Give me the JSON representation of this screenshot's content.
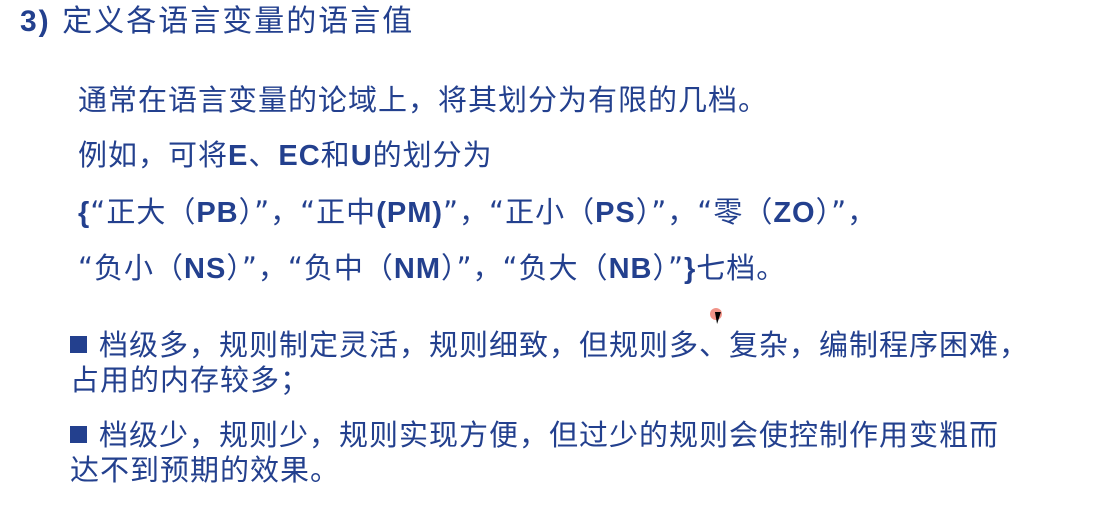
{
  "title": {
    "number": "3)",
    "text": "定义各语言变量的语言值"
  },
  "intro": "通常在语言变量的论域上，将其划分为有限的几档。",
  "example": {
    "prefix": "例如，可将",
    "e": "E",
    "sep1": "、",
    "ec": "EC",
    "and": "和",
    "u": "U",
    "suffix": "的划分为"
  },
  "set_line1": {
    "open": "{",
    "items": [
      "“正大（",
      "PB",
      "）”，“正中",
      "(PM)",
      "”，“正小（",
      "PS",
      "）”，“零（",
      "ZO",
      "）”，"
    ]
  },
  "set_line2": {
    "items": [
      "“负小（",
      "NS",
      "）”，“负中（",
      "NM",
      "）”，“负大（",
      "NB",
      "）”",
      "}",
      "七档。"
    ]
  },
  "bullets": [
    {
      "line1": "档级多，规则制定灵活，规则细致，但规则多、复杂，编制程序困难，",
      "line2": "占用的内存较多；"
    },
    {
      "line1": "档级少，规则少，规则实现方便，但过少的规则会使控制作用变粗而",
      "line2": "达不到预期的效果。"
    }
  ],
  "colors": {
    "text": "#23408e"
  }
}
